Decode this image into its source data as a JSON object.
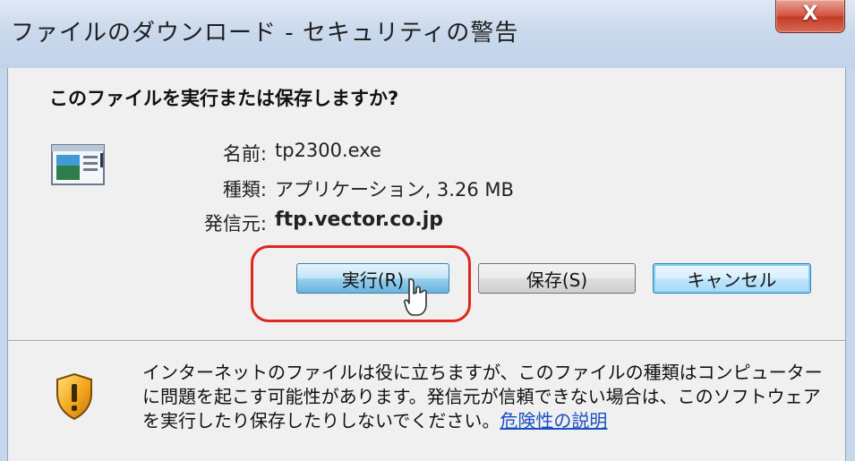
{
  "window": {
    "title": "ファイルのダウンロード - セキュリティの警告",
    "close_glyph": "X"
  },
  "dialog": {
    "question": "このファイルを実行または保存しますか?",
    "file_icon": "executable-file-icon",
    "fields": [
      {
        "label": "名前:",
        "value": "tp2300.exe"
      },
      {
        "label": "種類:",
        "value": "アプリケーション, 3.26 MB"
      },
      {
        "label": "発信元:",
        "value": "ftp.vector.co.jp"
      }
    ],
    "buttons": {
      "run": "実行(R)",
      "save": "保存(S)",
      "cancel": "キャンセル"
    },
    "warning_icon": "security-shield-icon",
    "warning_text": "インターネットのファイルは役に立ちますが、このファイルの種類はコンピューターに問題を起こす可能性があります。発信元が信頼できない場合は、このソフトウェアを実行したり保存したりしないでください。",
    "risk_link": "危険性の説明"
  },
  "colors": {
    "highlight_ring": "#e0271c",
    "link": "#1a4fc2",
    "close_button": "#c23a25"
  }
}
